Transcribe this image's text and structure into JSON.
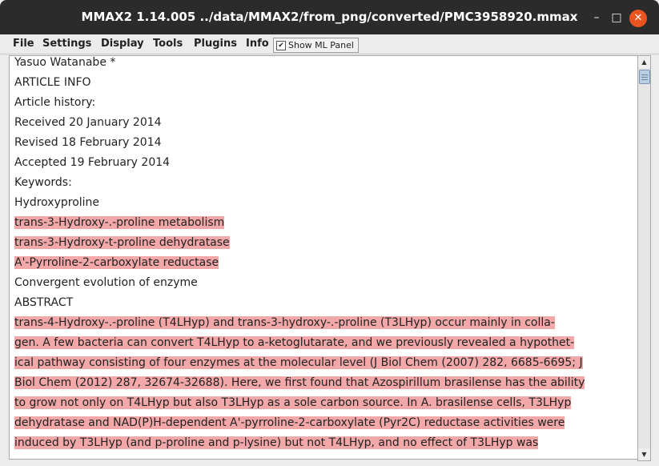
{
  "window": {
    "title": "MMAX2 1.14.005 ../data/MMAX2/from_png/converted/PMC3958920.mmax"
  },
  "window_controls": {
    "minimize": "–",
    "maximize": "□",
    "close": "✕"
  },
  "menubar": {
    "items": [
      "File",
      "Settings",
      "Display",
      "Tools",
      "Plugins",
      "Info"
    ],
    "ml_panel": {
      "label": "Show ML Panel",
      "checked": true,
      "check_glyph": "✔"
    }
  },
  "document": {
    "lines": [
      {
        "text": "Yasuo Watanabe *",
        "highlighted": false
      },
      {
        "text": "ARTICLE INFO",
        "highlighted": false
      },
      {
        "text": "Article history:",
        "highlighted": false
      },
      {
        "text": "Received 20 January 2014",
        "highlighted": false
      },
      {
        "text": "Revised 18 February 2014",
        "highlighted": false
      },
      {
        "text": "Accepted 19 February 2014",
        "highlighted": false
      },
      {
        "text": "Keywords:",
        "highlighted": false
      },
      {
        "text": "Hydroxyproline",
        "highlighted": false
      },
      {
        "text": "trans-3-Hydroxy-.-proline metabolism",
        "highlighted": true
      },
      {
        "text": "trans-3-Hydroxy-t-proline dehydratase",
        "highlighted": true
      },
      {
        "text": "A'-Pyrroline-2-carboxylate reductase",
        "highlighted": true
      },
      {
        "text": "Convergent evolution of enzyme",
        "highlighted": false
      },
      {
        "text": "ABSTRACT",
        "highlighted": false
      },
      {
        "text": "trans-4-Hydroxy-.-proline (T4LHyp) and trans-3-hydroxy-.-proline (T3LHyp) occur mainly in colla-",
        "highlighted": true
      },
      {
        "text": "gen. A few bacteria can convert T4LHyp to a-ketoglutarate, and we previously revealed a hypothet-",
        "highlighted": true
      },
      {
        "text": "ical pathway consisting of four enzymes at the molecular level (J Biol Chem (2007) 282, 6685-6695; J",
        "highlighted": true
      },
      {
        "text": "Biol Chem (2012) 287, 32674-32688). Here, we first found that Azospirillum brasilense has the ability",
        "highlighted": true
      },
      {
        "text": "to grow not only on T4LHyp but also T3LHyp as a sole carbon source. In A. brasilense cells, T3LHyp",
        "highlighted": true
      },
      {
        "text": "dehydratase and NAD(P)H-dependent A'-pyrroline-2-carboxylate (Pyr2C) reductase activities were",
        "highlighted": true
      },
      {
        "text": "induced by T3LHyp (and p-proline and p-lysine) but not T4LHyp, and no effect of T3LHyp was",
        "highlighted": true
      }
    ]
  },
  "scrollbar": {
    "up_arrow": "▲",
    "down_arrow": "▼"
  }
}
